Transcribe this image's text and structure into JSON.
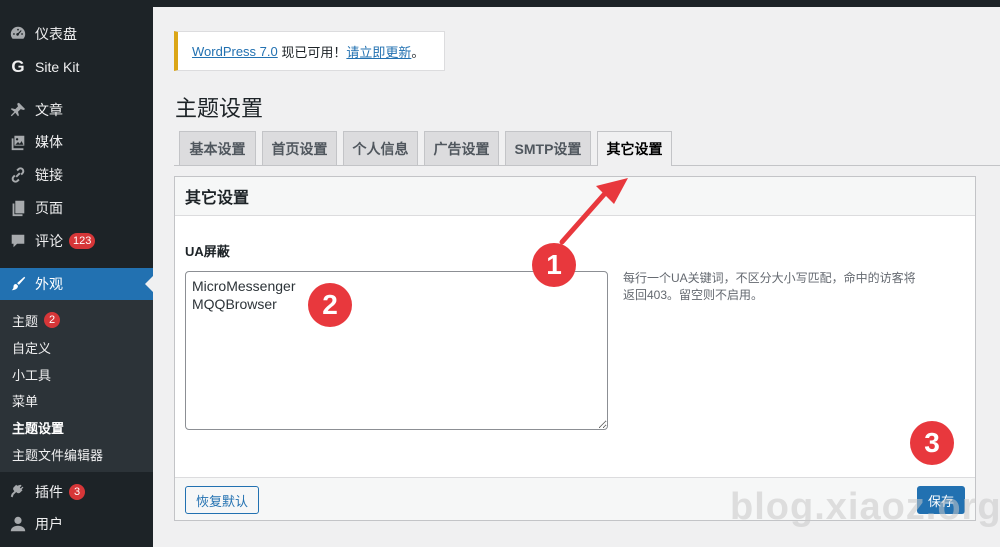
{
  "sidebar": {
    "menu": [
      {
        "label": "仪表盘",
        "icon": "dashboard-icon"
      },
      {
        "label": "Site Kit",
        "icon": "google-g-icon"
      },
      {
        "label": "文章",
        "icon": "pin-icon"
      },
      {
        "label": "媒体",
        "icon": "media-icon"
      },
      {
        "label": "链接",
        "icon": "link-icon"
      },
      {
        "label": "页面",
        "icon": "page-icon"
      },
      {
        "label": "评论",
        "icon": "comment-icon",
        "badge": "123"
      },
      {
        "label": "外观",
        "icon": "brush-icon",
        "current": true
      },
      {
        "label": "插件",
        "icon": "plugin-icon",
        "badge": "3"
      },
      {
        "label": "用户",
        "icon": "user-icon"
      }
    ],
    "submenu": [
      {
        "label": "主题",
        "badge": "2"
      },
      {
        "label": "自定义"
      },
      {
        "label": "小工具"
      },
      {
        "label": "菜单"
      },
      {
        "label": "主题设置",
        "current": true
      },
      {
        "label": "主题文件编辑器"
      }
    ]
  },
  "notice": {
    "link_version": "WordPress 7.0",
    "middle_text": " 现已可用！",
    "link_update": "请立即更新",
    "end_text": "。"
  },
  "page": {
    "title": "主题设置"
  },
  "tabs": [
    {
      "label": "基本设置"
    },
    {
      "label": "首页设置"
    },
    {
      "label": "个人信息"
    },
    {
      "label": "广告设置"
    },
    {
      "label": "SMTP设置"
    },
    {
      "label": "其它设置",
      "active": true
    }
  ],
  "panel": {
    "title": "其它设置",
    "field_label": "UA屏蔽",
    "textarea_value": "MicroMessenger\nMQQBrowser",
    "help_text": "每行一个UA关键词，不区分大小写匹配，命中的访客将返回403。留空则不启用。",
    "reset_label": "恢复默认",
    "save_label": "保存"
  },
  "annotations": {
    "m1": "1",
    "m2": "2",
    "m3": "3"
  },
  "watermark": "blog.xiaoz.org",
  "colors": {
    "sidebar_bg": "#1d2327",
    "accent": "#2271b1",
    "badge": "#d63638",
    "marker": "#e8383d",
    "notice_border": "#dba617"
  }
}
